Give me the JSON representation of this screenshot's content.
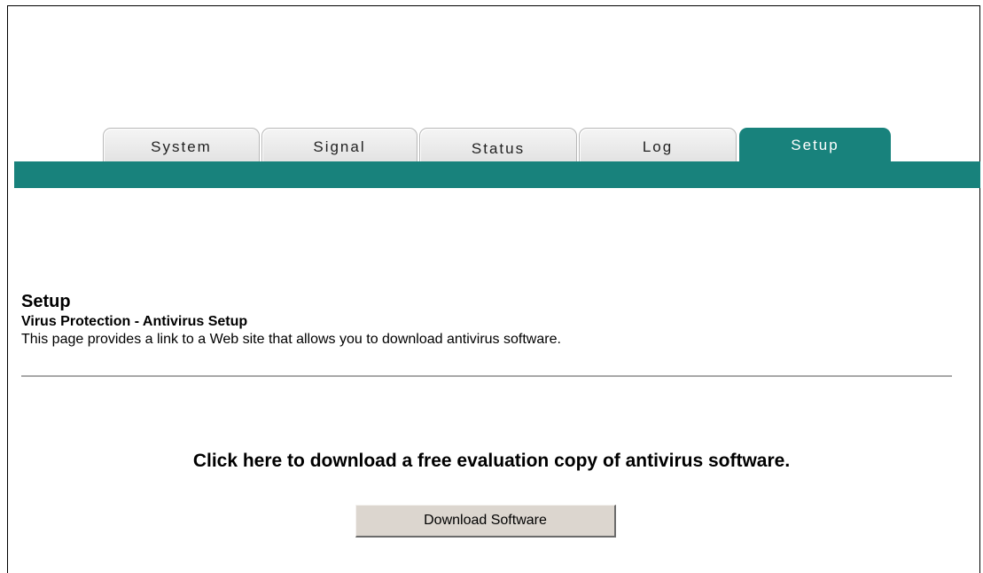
{
  "tabs": [
    {
      "label": "System",
      "active": false
    },
    {
      "label": "Signal",
      "active": false
    },
    {
      "label": "Status",
      "active": false
    },
    {
      "label": "Log",
      "active": false
    },
    {
      "label": "Setup",
      "active": true
    }
  ],
  "page": {
    "title": "Setup",
    "subtitle": "Virus Protection - Antivirus Setup",
    "description": "This page provides a link to a Web site that allows you to download antivirus software."
  },
  "download": {
    "prompt": "Click here to download a free evaluation copy of antivirus software.",
    "button_label": "Download Software"
  },
  "colors": {
    "accent": "#18827c",
    "tab_inactive": "#e8e8e8",
    "button_face": "#dcd6cf"
  }
}
